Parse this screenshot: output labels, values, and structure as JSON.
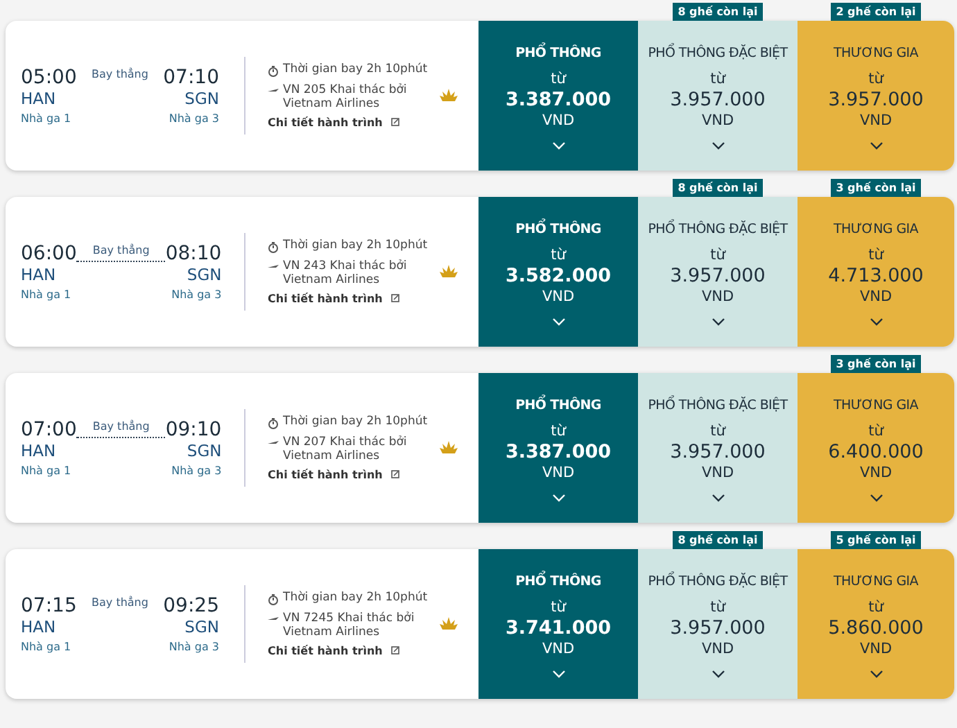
{
  "flights": [
    {
      "depart_time": "05:00",
      "depart_airport": "HAN",
      "depart_terminal": "Nhà ga 1",
      "stop_label": "Bay thẳng",
      "route_line": false,
      "arrive_time": "07:10",
      "arrive_airport": "SGN",
      "arrive_terminal": "Nhà ga 3",
      "duration": "Thời gian bay 2h 10phút",
      "flight_info": "VN 205 Khai thác bởi Vietnam Airlines",
      "details_link": "Chi tiết hành trình",
      "fares": [
        {
          "kind": "economy",
          "class_name": "PHỔ THÔNG",
          "from": "từ",
          "price": "3.387.000",
          "currency": "VND"
        },
        {
          "kind": "premium",
          "class_name": "PHỔ THÔNG ĐẶC BIỆT",
          "from": "từ",
          "price": "3.957.000",
          "currency": "VND",
          "seats_left": "8 ghế còn lại"
        },
        {
          "kind": "business",
          "class_name": "THƯƠNG GIA",
          "from": "từ",
          "price": "3.957.000",
          "currency": "VND",
          "seats_left": "2 ghế còn lại"
        }
      ]
    },
    {
      "depart_time": "06:00",
      "depart_airport": "HAN",
      "depart_terminal": "Nhà ga 1",
      "stop_label": "Bay thẳng",
      "route_line": true,
      "arrive_time": "08:10",
      "arrive_airport": "SGN",
      "arrive_terminal": "Nhà ga 3",
      "duration": "Thời gian bay 2h 10phút",
      "flight_info": "VN 243 Khai thác bởi Vietnam Airlines",
      "details_link": "Chi tiết hành trình",
      "fares": [
        {
          "kind": "economy",
          "class_name": "PHỔ THÔNG",
          "from": "từ",
          "price": "3.582.000",
          "currency": "VND"
        },
        {
          "kind": "premium",
          "class_name": "PHỔ THÔNG ĐẶC BIỆT",
          "from": "từ",
          "price": "3.957.000",
          "currency": "VND",
          "seats_left": "8 ghế còn lại"
        },
        {
          "kind": "business",
          "class_name": "THƯƠNG GIA",
          "from": "từ",
          "price": "4.713.000",
          "currency": "VND",
          "seats_left": "3 ghế còn lại"
        }
      ]
    },
    {
      "depart_time": "07:00",
      "depart_airport": "HAN",
      "depart_terminal": "Nhà ga 1",
      "stop_label": "Bay thẳng",
      "route_line": true,
      "arrive_time": "09:10",
      "arrive_airport": "SGN",
      "arrive_terminal": "Nhà ga 3",
      "duration": "Thời gian bay 2h 10phút",
      "flight_info": "VN 207 Khai thác bởi Vietnam Airlines",
      "details_link": "Chi tiết hành trình",
      "fares": [
        {
          "kind": "economy",
          "class_name": "PHỔ THÔNG",
          "from": "từ",
          "price": "3.387.000",
          "currency": "VND"
        },
        {
          "kind": "premium",
          "class_name": "PHỔ THÔNG ĐẶC BIỆT",
          "from": "từ",
          "price": "3.957.000",
          "currency": "VND"
        },
        {
          "kind": "business",
          "class_name": "THƯƠNG GIA",
          "from": "từ",
          "price": "6.400.000",
          "currency": "VND",
          "seats_left": "3 ghế còn lại"
        }
      ]
    },
    {
      "depart_time": "07:15",
      "depart_airport": "HAN",
      "depart_terminal": "Nhà ga 1",
      "stop_label": "Bay thẳng",
      "route_line": false,
      "arrive_time": "09:25",
      "arrive_airport": "SGN",
      "arrive_terminal": "Nhà ga 3",
      "duration": "Thời gian bay 2h 10phút",
      "flight_info": "VN 7245 Khai thác bởi Vietnam Airlines",
      "details_link": "Chi tiết hành trình",
      "fares": [
        {
          "kind": "economy",
          "class_name": "PHỔ THÔNG",
          "from": "từ",
          "price": "3.741.000",
          "currency": "VND"
        },
        {
          "kind": "premium",
          "class_name": "PHỔ THÔNG ĐẶC BIỆT",
          "from": "từ",
          "price": "3.957.000",
          "currency": "VND",
          "seats_left": "8 ghế còn lại"
        },
        {
          "kind": "business",
          "class_name": "THƯƠNG GIA",
          "from": "từ",
          "price": "5.860.000",
          "currency": "VND",
          "seats_left": "5 ghế còn lại"
        }
      ]
    }
  ]
}
